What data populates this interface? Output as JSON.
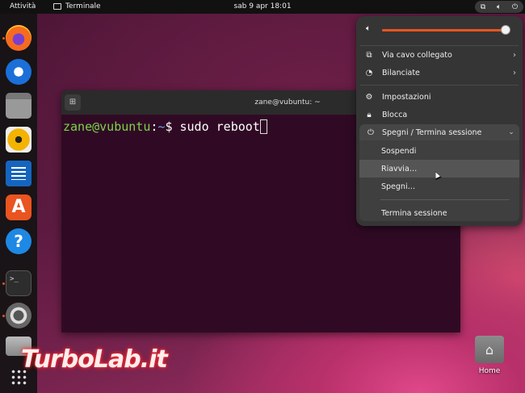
{
  "topbar": {
    "activities": "Attività",
    "app_name": "Terminale",
    "clock": "sab 9 apr  18:01",
    "tray_icons": [
      "network-icon",
      "volume-icon",
      "power-icon"
    ]
  },
  "dock": {
    "apps": [
      "firefox",
      "thunderbird",
      "files",
      "rhythmbox",
      "libreoffice-writer",
      "app-center",
      "help",
      "terminal",
      "settings",
      "extra-app"
    ],
    "running_dots": [
      "firefox",
      "terminal",
      "settings"
    ],
    "terminal_glyph": ">_"
  },
  "terminal": {
    "title": "zane@vubuntu: ~",
    "prompt_user": "zane@vubuntu",
    "prompt_sep": ":",
    "prompt_path": "~",
    "prompt_sign": "$ ",
    "command": "sudo reboot"
  },
  "menu": {
    "volume_level": 0.98,
    "items": {
      "wired": "Via cavo collegato",
      "balanced": "Bilanciate",
      "settings": "Impostazioni",
      "lock": "Blocca",
      "power_header": "Spegni / Termina sessione"
    },
    "power_submenu": {
      "suspend": "Sospendi",
      "restart": "Riavvia…",
      "poweroff": "Spegni…",
      "logout": "Termina sessione"
    }
  },
  "desktop": {
    "home_label": "Home"
  },
  "watermark": "TurboLab.it",
  "colors": {
    "accent": "#e95420",
    "prompt_green": "#7dd34c",
    "prompt_blue": "#6fa3e6",
    "terminal_bg": "#300a24"
  }
}
